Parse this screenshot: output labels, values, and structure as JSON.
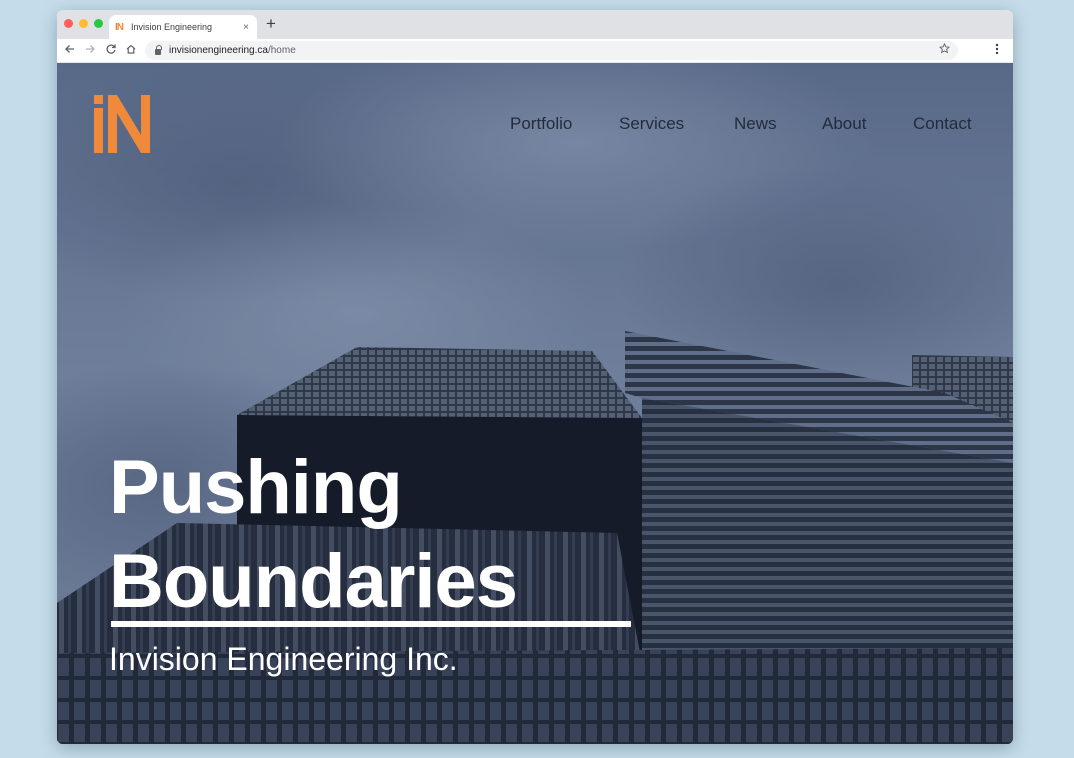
{
  "browser": {
    "tab_title": "Invision Engineering",
    "tab_favicon": "IN",
    "close_glyph": "×",
    "new_tab_glyph": "+",
    "url_host": "invisionengineering.ca",
    "url_path": "/home",
    "icons": [
      "back-arrow-icon",
      "forward-arrow-icon",
      "reload-icon",
      "home-icon",
      "lock-icon",
      "star-icon",
      "menu-icon"
    ]
  },
  "site": {
    "nav": [
      {
        "label": "Portfolio"
      },
      {
        "label": "Services"
      },
      {
        "label": "News"
      },
      {
        "label": "About"
      },
      {
        "label": "Contact"
      }
    ],
    "hero": {
      "title_line1": "Pushing",
      "title_line2": "Boundaries",
      "subtitle": "Invision Engineering Inc."
    }
  },
  "colors": {
    "brand_orange": "#f08a3a",
    "nav_text": "#232c3a",
    "sky": "#6a7a98",
    "building": "#3a4354"
  }
}
